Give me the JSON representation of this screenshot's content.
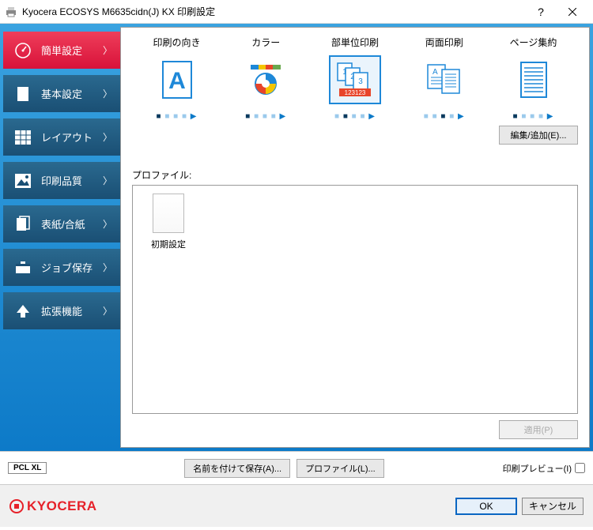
{
  "window": {
    "title": "Kyocera ECOSYS M6635cidn(J) KX 印刷設定"
  },
  "sidebar": {
    "items": [
      {
        "label": "簡単設定",
        "icon": "gauge-icon"
      },
      {
        "label": "基本設定",
        "icon": "page-icon"
      },
      {
        "label": "レイアウト",
        "icon": "layout-grid-icon"
      },
      {
        "label": "印刷品質",
        "icon": "image-quality-icon"
      },
      {
        "label": "表紙/合紙",
        "icon": "cover-icon"
      },
      {
        "label": "ジョブ保存",
        "icon": "job-box-icon"
      },
      {
        "label": "拡張機能",
        "icon": "arrow-up-icon"
      }
    ]
  },
  "quick": {
    "items": [
      {
        "label": "印刷の向き"
      },
      {
        "label": "カラー"
      },
      {
        "label": "部単位印刷"
      },
      {
        "label": "両面印刷"
      },
      {
        "label": "ページ集約"
      }
    ],
    "edit_button": "編集/追加(E)..."
  },
  "profiles": {
    "label": "プロファイル:",
    "items": [
      {
        "name": "初期設定"
      }
    ],
    "apply_button": "適用(P)"
  },
  "footer": {
    "pcl_badge": "PCL XL",
    "save_as": "名前を付けて保存(A)...",
    "profile_btn": "プロファイル(L)...",
    "preview_label": "印刷プレビュー(I)",
    "ok": "OK",
    "cancel": "キャンセル",
    "brand": "KYOCERA"
  }
}
